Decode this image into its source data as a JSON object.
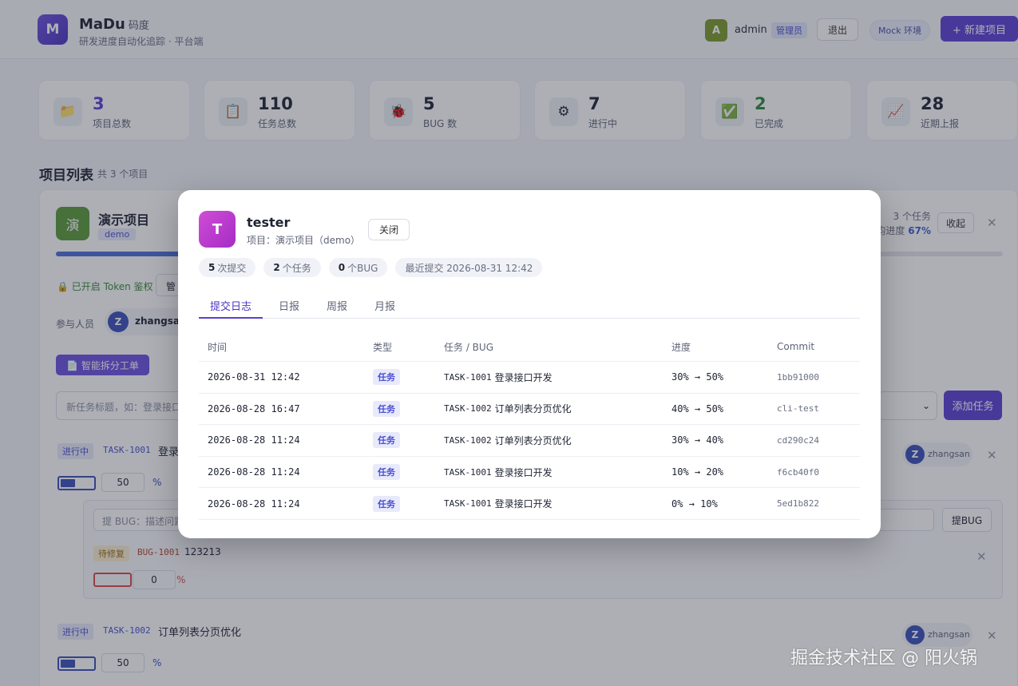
{
  "app": {
    "logo_letter": "M",
    "brand": "MaDu",
    "brand_cn": "码度",
    "subtitle": "研发进度自动化追踪 · 平台端"
  },
  "header": {
    "avatar_letter": "A",
    "user": "admin",
    "role": "管理员",
    "logout": "退出",
    "env": "Mock 环境",
    "new_project": "+ 新建项目"
  },
  "stats": [
    {
      "value": "3",
      "label": "项目总数",
      "icon": "folder-icon",
      "glyph": "📁",
      "color": "#5b3fd4"
    },
    {
      "value": "110",
      "label": "任务总数",
      "icon": "clipboard-icon",
      "glyph": "📋",
      "color": "#1f2333"
    },
    {
      "value": "5",
      "label": "BUG 数",
      "icon": "bug-icon",
      "glyph": "🐞",
      "color": "#1f2333"
    },
    {
      "value": "7",
      "label": "进行中",
      "icon": "gear-icon",
      "glyph": "⚙",
      "color": "#1f2333"
    },
    {
      "value": "2",
      "label": "已完成",
      "icon": "check-icon",
      "glyph": "✅",
      "color": "#2a8a3a"
    },
    {
      "value": "28",
      "label": "近期上报",
      "icon": "chart-icon",
      "glyph": "📈",
      "color": "#1f2333"
    }
  ],
  "section": {
    "title": "项目列表",
    "subtitle": "共 3 个项目"
  },
  "project": {
    "icon_char": "演",
    "name": "演示项目",
    "tag": "demo",
    "task_count": "3 个任务",
    "avg_label": "平均进度",
    "avg_value": "67%",
    "progress": 0.67,
    "collapse": "收起",
    "token": "🔒 已开启 Token 鉴权",
    "manage": "管",
    "members_label": "参与人员",
    "member_letter": "Z",
    "member_name": "zhangsan",
    "split_btn": "📄 智能拆分工单",
    "task_placeholder": "新任务标题，如：登录接口",
    "add_task": "添加任务",
    "tasks": [
      {
        "status": "进行中",
        "code": "TASK-1001",
        "title": "登录",
        "value": "50",
        "pct": "%",
        "assignee_letter": "Z",
        "assignee": "zhangsan"
      },
      {
        "status": "进行中",
        "code": "TASK-1002",
        "title": "订单列表分页优化",
        "value": "50",
        "pct": "%",
        "assignee_letter": "Z",
        "assignee": "zhangsan"
      }
    ],
    "bug_placeholder": "提 BUG：描述问题",
    "bug_btn": "提BUG",
    "bug": {
      "status": "待修复",
      "code": "BUG-1001",
      "title": "123213",
      "value": "0",
      "pct": "%"
    }
  },
  "modal": {
    "avatar_letter": "T",
    "name": "tester",
    "project": "项目：演示项目（demo）",
    "close": "关闭",
    "chips": [
      {
        "num": "5",
        "text": "次提交"
      },
      {
        "num": "2",
        "text": "个任务"
      },
      {
        "num": "0",
        "text": "个BUG"
      },
      {
        "num": "",
        "text": "最近提交 2026-08-31 12:42"
      }
    ],
    "tabs": [
      "提交日志",
      "日报",
      "周报",
      "月报"
    ],
    "columns": [
      "时间",
      "类型",
      "任务 / BUG",
      "进度",
      "Commit"
    ],
    "rows": [
      {
        "time": "2026-08-31 12:42",
        "type": "任务",
        "code": "TASK-1001",
        "title": "登录接口开发",
        "progress": "30% → 50%",
        "commit": "1bb91000"
      },
      {
        "time": "2026-08-28 16:47",
        "type": "任务",
        "code": "TASK-1002",
        "title": "订单列表分页优化",
        "progress": "40% → 50%",
        "commit": "cli-test"
      },
      {
        "time": "2026-08-28 11:24",
        "type": "任务",
        "code": "TASK-1002",
        "title": "订单列表分页优化",
        "progress": "30% → 40%",
        "commit": "cd290c24"
      },
      {
        "time": "2026-08-28 11:24",
        "type": "任务",
        "code": "TASK-1001",
        "title": "登录接口开发",
        "progress": "10% → 20%",
        "commit": "f6cb40f0"
      },
      {
        "time": "2026-08-28 11:24",
        "type": "任务",
        "code": "TASK-1001",
        "title": "登录接口开发",
        "progress": "0% → 10%",
        "commit": "5ed1b822"
      }
    ]
  },
  "watermark": "掘金技术社区 @ 阳火锅"
}
